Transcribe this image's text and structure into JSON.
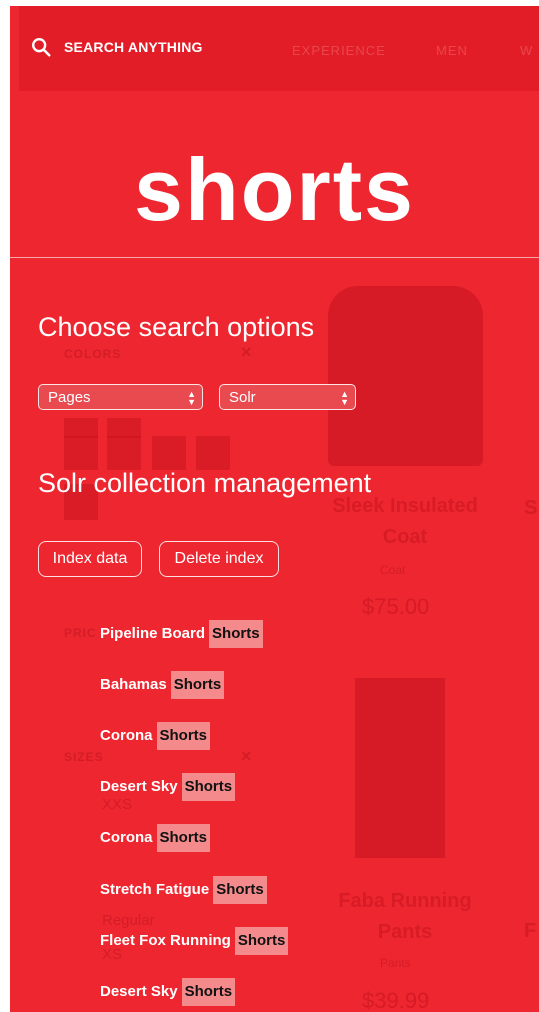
{
  "header": {
    "search_label": "SEARCH ANYTHING",
    "nav": [
      "EXPERIENCE",
      "MEN",
      "W"
    ]
  },
  "background": {
    "colors_label": "COLORS",
    "price_label": "PRIC",
    "sizes_label": "SIZES",
    "close_glyph": "×",
    "sizes": [
      "XXS",
      "Regular",
      "XS"
    ],
    "products": [
      {
        "name": "Sleek Insulated Coat",
        "sub": "Coat",
        "price": "$75.00"
      },
      {
        "name": "Faba Running Pants",
        "sub": "Pants",
        "price": "$39.99"
      }
    ],
    "edge_letters": [
      "S",
      "F"
    ]
  },
  "hero_title": "shorts",
  "options": {
    "title": "Choose search options",
    "select_type": "Pages",
    "select_engine": "Solr"
  },
  "collection": {
    "title": "Solr collection management",
    "index_label": "Index data",
    "delete_label": "Delete index"
  },
  "results": [
    {
      "prefix": "Pipeline Board",
      "match": "Shorts"
    },
    {
      "prefix": "Bahamas",
      "match": "Shorts"
    },
    {
      "prefix": "Corona",
      "match": "Shorts"
    },
    {
      "prefix": "Desert Sky",
      "match": "Shorts"
    },
    {
      "prefix": "Corona",
      "match": "Shorts"
    },
    {
      "prefix": "Stretch Fatigue",
      "match": "Shorts"
    },
    {
      "prefix": "Fleet Fox Running",
      "match": "Shorts"
    },
    {
      "prefix": "Desert Sky",
      "match": "Shorts"
    }
  ],
  "colors": {
    "background": "#ee2630",
    "topbar": "#e31d27",
    "highlight": "#f48a8c"
  }
}
